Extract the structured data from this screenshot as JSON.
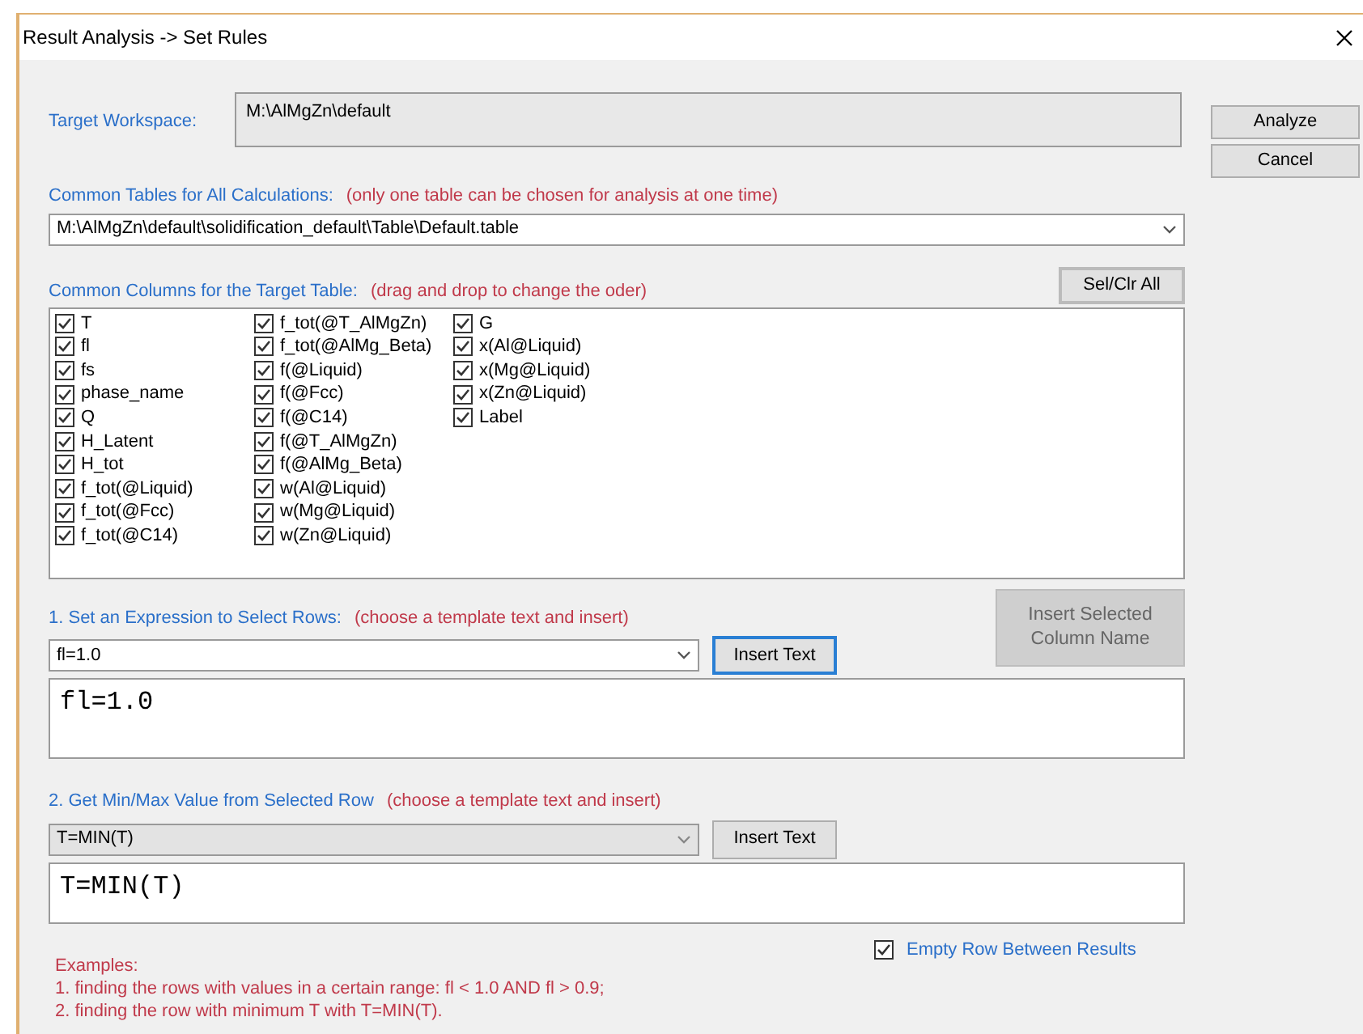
{
  "window": {
    "title": "Result Analysis -> Set Rules"
  },
  "target_workspace": {
    "label": "Target Workspace:",
    "value": "M:\\AlMgZn\\default"
  },
  "buttons": [
    {
      "label": "Analyze"
    },
    {
      "label": "Cancel"
    }
  ],
  "common_tables": {
    "label": "Common Tables for All Calculations:",
    "note": "(only one table can be chosen for analysis at one time)",
    "value": "M:\\AlMgZn\\default\\solidification_default\\Table\\Default.table"
  },
  "common_columns": {
    "label": "Common Columns for the Target Table:",
    "note": "(drag and drop to change the oder)",
    "button": "Sel/Clr All",
    "column_groups": [
      {
        "items": [
          {
            "label": "T",
            "checked": true
          },
          {
            "label": "fl",
            "checked": true
          },
          {
            "label": "fs",
            "checked": true
          },
          {
            "label": "phase_name",
            "checked": true
          },
          {
            "label": "Q",
            "checked": true
          },
          {
            "label": "H_Latent",
            "checked": true
          },
          {
            "label": "H_tot",
            "checked": true
          },
          {
            "label": "f_tot(@Liquid)",
            "checked": true
          },
          {
            "label": "f_tot(@Fcc)",
            "checked": true
          },
          {
            "label": "f_tot(@C14)",
            "checked": true
          }
        ]
      },
      {
        "items": [
          {
            "label": "f_tot(@T_AlMgZn)",
            "checked": true
          },
          {
            "label": "f_tot(@AlMg_Beta)",
            "checked": true
          },
          {
            "label": "f(@Liquid)",
            "checked": true
          },
          {
            "label": "f(@Fcc)",
            "checked": true
          },
          {
            "label": "f(@C14)",
            "checked": true
          },
          {
            "label": "f(@T_AlMgZn)",
            "checked": true
          },
          {
            "label": "f(@AlMg_Beta)",
            "checked": true
          },
          {
            "label": "w(Al@Liquid)",
            "checked": true
          },
          {
            "label": "w(Mg@Liquid)",
            "checked": true
          },
          {
            "label": "w(Zn@Liquid)",
            "checked": true
          }
        ]
      },
      {
        "items": [
          {
            "label": "G",
            "checked": true
          },
          {
            "label": "x(Al@Liquid)",
            "checked": true
          },
          {
            "label": "x(Mg@Liquid)",
            "checked": true
          },
          {
            "label": "x(Zn@Liquid)",
            "checked": true
          },
          {
            "label": "Label",
            "checked": true
          }
        ]
      }
    ]
  },
  "insert_selected_button": {
    "label": "Insert Selected Column Name",
    "disabled": true
  },
  "sections": [
    {
      "label": "1. Set an Expression to Select Rows:",
      "note": "(choose a template text and insert)",
      "template": "fl=1.0",
      "template_disabled": false,
      "insert_button": "Insert Text",
      "insert_focused": true,
      "text": "fl=1.0"
    },
    {
      "label": "2. Get Min/Max Value from Selected Row",
      "note": "(choose a template text and insert)",
      "template": "T=MIN(T)",
      "template_disabled": true,
      "insert_button": "Insert Text",
      "insert_focused": false,
      "text": "T=MIN(T)"
    }
  ],
  "empty_row": {
    "label": "Empty Row Between Results",
    "checked": true
  },
  "examples": [
    "Examples:",
    "1. finding the rows with values in a certain range: fl < 1.0 AND fl > 0.9;",
    "2. finding the row with minimum T with T=MIN(T)."
  ]
}
